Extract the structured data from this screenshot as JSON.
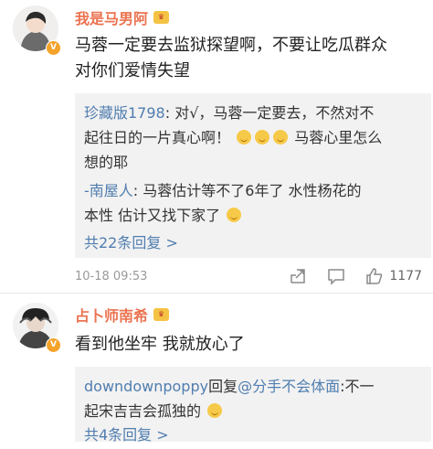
{
  "comments": [
    {
      "username": "我是马男阿",
      "text_line1": "马蓉一定要去监狱探望啊，不要让吃瓜群众",
      "text_line2": "对你们爱情失望",
      "replies": [
        {
          "author": "珍藏版1798",
          "text_a": ": 对√，马蓉一定要去，不然对不",
          "text_b": "起往日的一片真心啊！",
          "text_c": "马蓉心里怎么",
          "text_d": "想的耶"
        },
        {
          "author": "-南屋人",
          "text_a": ": 马蓉估计等不了6年了 水性杨花的",
          "text_b": "本性 估计又找下家了"
        }
      ],
      "more_replies": "共22条回复 >",
      "time": "10-18 09:53",
      "likes": "1177"
    },
    {
      "username": "占卜师南希",
      "text_line1": "看到他坐牢 我就放心了",
      "replies": [
        {
          "author": "downdownpoppy",
          "mid": "回复",
          "target": "@分手不会体面",
          "text_a": ":不一",
          "text_b": "起宋吉吉会孤独的"
        }
      ],
      "more_replies": "共4条回复 >"
    }
  ],
  "colors": {
    "username": "#eb7350",
    "link": "#507daf",
    "quote_bg": "#f2f2f2",
    "badge": "#f4a32a"
  },
  "icons": [
    "verified-badge-icon",
    "vip-crown-icon",
    "share-icon",
    "comment-icon",
    "like-icon",
    "emoji-icon"
  ]
}
